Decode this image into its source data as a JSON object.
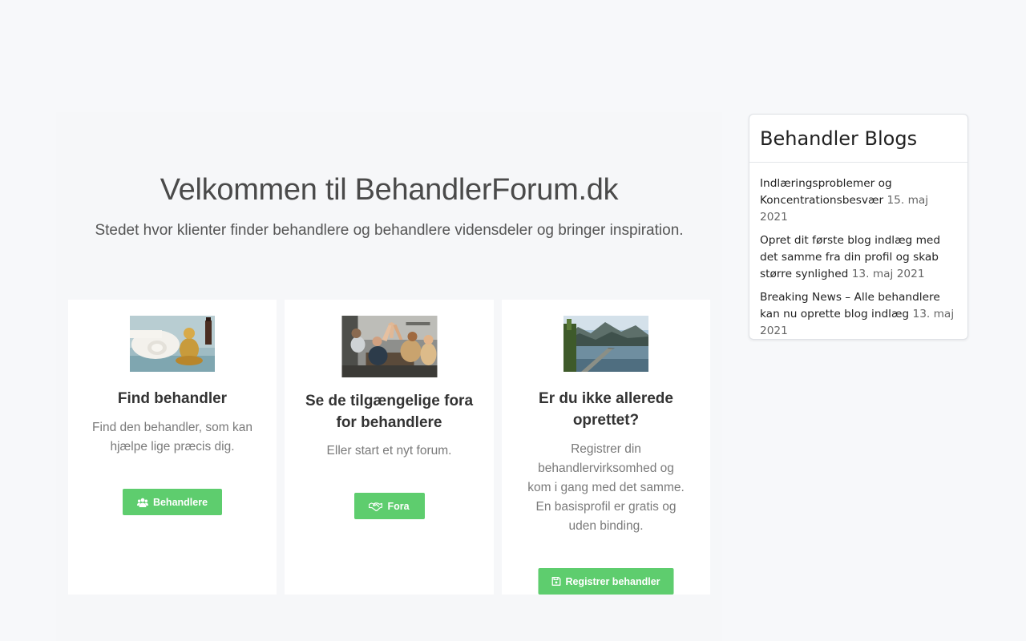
{
  "hero": {
    "title": "Velkommen til BehandlerForum.dk",
    "subtitle": "Stedet hvor klienter finder behandlere og behandlere vidensdeler og bringer inspiration."
  },
  "cards": [
    {
      "title": "Find behandler",
      "text": "Find den behandler, som kan hjælpe lige præcis dig.",
      "button": "Behandlere",
      "button_icon": "users-icon"
    },
    {
      "title": "Se de tilgængelige fora for behandlere",
      "text": "Eller start et nyt forum.",
      "button": "Fora",
      "button_icon": "handshake-icon"
    },
    {
      "title": "Er du ikke allerede oprettet?",
      "text": "Registrer din behandlervirksomhed og kom i gang med det samme. En basisprofil er gratis og uden binding.",
      "button": "Registrer behandler",
      "button_icon": "save-icon"
    }
  ],
  "sidebar": {
    "title": "Behandler Blogs",
    "posts": [
      {
        "title": "Indlæringsproblemer og Koncentrationsbesvær",
        "date": "15. maj 2021"
      },
      {
        "title": "Opret dit første blog indlæg med det samme fra din profil og skab større synlighed",
        "date": "13. maj 2021"
      },
      {
        "title": "Breaking News – Alle behandlere kan nu oprette blog indlæg",
        "date": "13. maj 2021"
      }
    ]
  },
  "colors": {
    "button_green": "#5ecd6e",
    "page_background": "#f7f8fa",
    "card_background": "#ffffff"
  }
}
